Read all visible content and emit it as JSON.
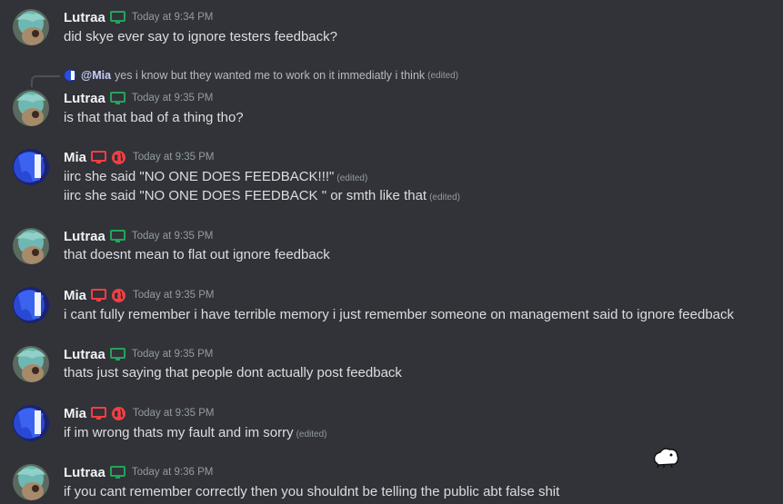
{
  "colors": {
    "background": "#313338",
    "lutraa_tag": "#23a55a",
    "mia_tag": "#f23f43",
    "timestamp": "#949ba4",
    "text": "#dbdee1"
  },
  "messages": [
    {
      "author": "Lutraa",
      "icons": [
        "monitor-icon"
      ],
      "time": "Today at 9:34 PM",
      "lines": [
        {
          "text": "did skye ever say to ignore testers feedback?",
          "edited": ""
        }
      ]
    },
    {
      "author": "Lutraa",
      "icons": [
        "monitor-icon"
      ],
      "time": "Today at 9:35 PM",
      "reply": {
        "mention": "@Mia",
        "text": "yes i know but they wanted me to work on it immediatly i think",
        "edited": "(edited)"
      },
      "lines": [
        {
          "text": "is that that bad of a thing tho?",
          "edited": ""
        }
      ]
    },
    {
      "author": "Mia",
      "icons": [
        "monitor-icon",
        "globe-icon"
      ],
      "time": "Today at 9:35 PM",
      "lines": [
        {
          "text": "iirc she said \"NO ONE DOES FEEDBACK!!!\"",
          "edited": "(edited)"
        },
        {
          "text": "iirc she said \"NO ONE DOES FEEDBACK \" or smth like that",
          "edited": "(edited)"
        }
      ]
    },
    {
      "author": "Lutraa",
      "icons": [
        "monitor-icon"
      ],
      "time": "Today at 9:35 PM",
      "lines": [
        {
          "text": "that doesnt mean to flat out ignore feedback",
          "edited": ""
        }
      ]
    },
    {
      "author": "Mia",
      "icons": [
        "monitor-icon",
        "globe-icon"
      ],
      "time": "Today at 9:35 PM",
      "lines": [
        {
          "text": "i cant fully remember i have terrible memory i just remember someone on management said to ignore feedback",
          "edited": ""
        }
      ]
    },
    {
      "author": "Lutraa",
      "icons": [
        "monitor-icon"
      ],
      "time": "Today at 9:35 PM",
      "lines": [
        {
          "text": "thats just saying that people dont actually post feedback",
          "edited": ""
        }
      ]
    },
    {
      "author": "Mia",
      "icons": [
        "monitor-icon",
        "globe-icon"
      ],
      "time": "Today at 9:35 PM",
      "lines": [
        {
          "text": "if im wrong thats my fault and im sorry",
          "edited": "(edited)"
        }
      ]
    },
    {
      "author": "Lutraa",
      "icons": [
        "monitor-icon"
      ],
      "time": "Today at 9:36 PM",
      "lines": [
        {
          "text": "if you cant remember correctly then you shouldnt be telling the public abt false shit",
          "edited": ""
        }
      ]
    }
  ]
}
